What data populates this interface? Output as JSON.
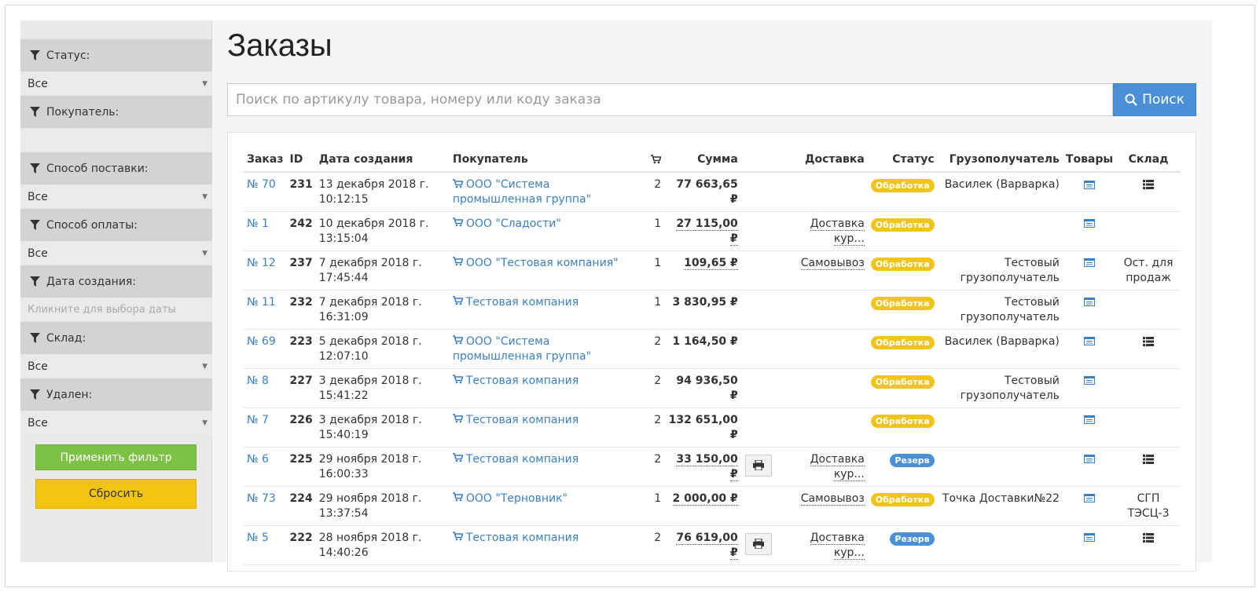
{
  "sidebar": {
    "filters": [
      {
        "label": "Статус:",
        "value": "Все",
        "type": "select"
      },
      {
        "label": "Покупатель:",
        "value": "",
        "type": "text"
      },
      {
        "label": "Способ поставки:",
        "value": "Все",
        "type": "select"
      },
      {
        "label": "Способ оплаты:",
        "value": "Все",
        "type": "select"
      },
      {
        "label": "Дата создания:",
        "value": "Кликните для выбора даты",
        "type": "date"
      },
      {
        "label": "Склад:",
        "value": "Все",
        "type": "select"
      },
      {
        "label": "Удален:",
        "value": "Все",
        "type": "select"
      }
    ],
    "apply_label": "Применить фильтр",
    "reset_label": "Сбросить"
  },
  "main": {
    "title": "Заказы",
    "search_placeholder": "Поиск по артикулу товара, номеру или коду заказа",
    "search_button": "Поиск"
  },
  "table": {
    "headers": {
      "order": "Заказ",
      "id": "ID",
      "date": "Дата создания",
      "buyer": "Покупатель",
      "sum": "Сумма",
      "delivery": "Доставка",
      "status": "Статус",
      "consignee": "Грузополучатель",
      "goods": "Товары",
      "warehouse": "Склад"
    },
    "rows": [
      {
        "order": "№ 70",
        "id": "231",
        "date": "13 декабря 2018 г.",
        "time": "10:12:15",
        "buyer": "ООО \"Система промышленная группа\"",
        "qty": "2",
        "sum": "77 663,65 ₽",
        "sum_dotted": false,
        "print": false,
        "delivery": "",
        "status": "Обработка",
        "status_color": "#f0c419",
        "consignee": "Василек (Варварка)",
        "warehouse": "",
        "warehouse_icon": true
      },
      {
        "order": "№ 1",
        "id": "242",
        "date": "10 декабря 2018 г.",
        "time": "13:15:04",
        "buyer": "ООО \"Сладости\"",
        "qty": "1",
        "sum": "27 115,00 ₽",
        "sum_dotted": true,
        "print": false,
        "delivery": "Доставка кур...",
        "status": "Обработка",
        "status_color": "#f0c419",
        "consignee": "",
        "warehouse": "",
        "warehouse_icon": false
      },
      {
        "order": "№ 12",
        "id": "237",
        "date": "7 декабря 2018 г.",
        "time": "17:45:44",
        "buyer": "ООО \"Тестовая компания\"",
        "qty": "1",
        "sum": "109,65 ₽",
        "sum_dotted": true,
        "print": false,
        "delivery": "Самовывоз",
        "status": "Обработка",
        "status_color": "#f0c419",
        "consignee": "Тестовый грузополучатель",
        "warehouse": "Ост. для продаж",
        "warehouse_icon": false
      },
      {
        "order": "№ 11",
        "id": "232",
        "date": "7 декабря 2018 г.",
        "time": "16:31:09",
        "buyer": "Тестовая компания",
        "qty": "1",
        "sum": "3 830,95 ₽",
        "sum_dotted": false,
        "print": false,
        "delivery": "",
        "status": "Обработка",
        "status_color": "#f0c419",
        "consignee": "Тестовый грузополучатель",
        "warehouse": "",
        "warehouse_icon": false
      },
      {
        "order": "№ 69",
        "id": "223",
        "date": "5 декабря 2018 г.",
        "time": "12:07:10",
        "buyer": "ООО \"Система промышленная группа\"",
        "qty": "2",
        "sum": "1 164,50 ₽",
        "sum_dotted": false,
        "print": false,
        "delivery": "",
        "status": "Обработка",
        "status_color": "#f0c419",
        "consignee": "Василек (Варварка)",
        "warehouse": "",
        "warehouse_icon": true
      },
      {
        "order": "№ 8",
        "id": "227",
        "date": "3 декабря 2018 г.",
        "time": "15:41:22",
        "buyer": "Тестовая компания",
        "qty": "2",
        "sum": "94 936,50 ₽",
        "sum_dotted": false,
        "print": false,
        "delivery": "",
        "status": "Обработка",
        "status_color": "#f0c419",
        "consignee": "Тестовый грузополучатель",
        "warehouse": "",
        "warehouse_icon": false
      },
      {
        "order": "№ 7",
        "id": "226",
        "date": "3 декабря 2018 г.",
        "time": "15:40:19",
        "buyer": "Тестовая компания",
        "qty": "2",
        "sum": "132 651,00 ₽",
        "sum_dotted": false,
        "print": false,
        "delivery": "",
        "status": "Обработка",
        "status_color": "#f0c419",
        "consignee": "",
        "warehouse": "",
        "warehouse_icon": false
      },
      {
        "order": "№ 6",
        "id": "225",
        "date": "29 ноября 2018 г.",
        "time": "16:00:33",
        "buyer": "Тестовая компания",
        "qty": "2",
        "sum": "33 150,00 ₽",
        "sum_dotted": true,
        "print": true,
        "delivery": "Доставка кур...",
        "status": "Резерв",
        "status_color": "#4a90d9",
        "consignee": "",
        "warehouse": "",
        "warehouse_icon": true
      },
      {
        "order": "№ 73",
        "id": "224",
        "date": "29 ноября 2018 г.",
        "time": "13:37:54",
        "buyer": "ООО \"Терновник\"",
        "qty": "1",
        "sum": "2 000,00 ₽",
        "sum_dotted": true,
        "print": false,
        "delivery": "Самовывоз",
        "status": "Обработка",
        "status_color": "#f0c419",
        "consignee": "Точка Доставки№22",
        "warehouse": "СГП ТЭСЦ-3",
        "warehouse_icon": false
      },
      {
        "order": "№ 5",
        "id": "222",
        "date": "28 ноября 2018 г.",
        "time": "14:40:26",
        "buyer": "Тестовая компания",
        "qty": "2",
        "sum": "76 619,00 ₽",
        "sum_dotted": true,
        "print": true,
        "delivery": "Доставка кур...",
        "status": "Резерв",
        "status_color": "#4a90d9",
        "consignee": "",
        "warehouse": "",
        "warehouse_icon": true
      }
    ]
  },
  "colors": {
    "accent": "#4a90d9",
    "apply": "#7dc245",
    "reset": "#f1c40f",
    "link": "#3a7fc4"
  }
}
